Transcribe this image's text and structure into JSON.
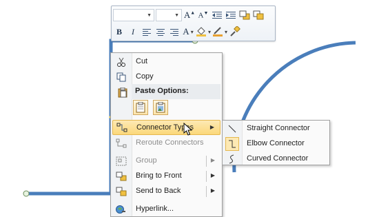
{
  "mini_toolbar": {
    "font_combo": "",
    "size_combo": "",
    "row1": [
      "grow-font",
      "shrink-font",
      "decrease-indent",
      "increase-indent",
      "bring-forward",
      "send-backward"
    ],
    "row2": {
      "bold": "B",
      "italic": "I",
      "font_color": "A",
      "grow_font": "A",
      "shrink_font": "A"
    }
  },
  "context_menu": {
    "cut": "Cut",
    "copy": "Copy",
    "paste_options": "Paste Options:",
    "connector_types": "Connector Types",
    "reroute": "Reroute Connectors",
    "group": "Group",
    "bring_to_front": "Bring to Front",
    "send_to_back": "Send to Back",
    "hyperlink": "Hyperlink..."
  },
  "submenu": {
    "straight": "Straight Connector",
    "elbow": "Elbow Connector",
    "curved": "Curved Connector"
  },
  "colors": {
    "connector": "#4a7ebb",
    "highlight": "#fbd87a",
    "menu_border": "#a0a0a0"
  }
}
